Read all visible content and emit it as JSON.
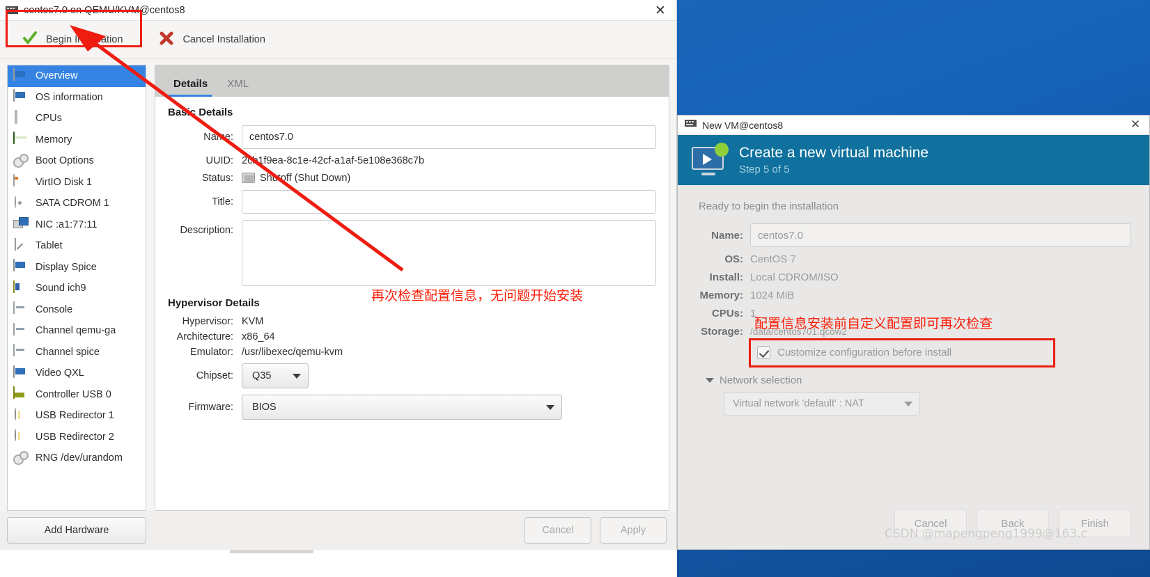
{
  "vm_window": {
    "title": "centos7.0 on QEMU/KVM@centos8",
    "title_icon": "vm-icon",
    "close_label": "✕",
    "toolbar": {
      "begin_label": "Begin Installation",
      "begin_icon": "green-check-icon",
      "cancel_label": "Cancel Installation",
      "cancel_icon": "red-x-icon"
    },
    "hardware_list": [
      {
        "label": "Overview",
        "icon": "monitor-icon",
        "selected": true
      },
      {
        "label": "OS information",
        "icon": "monitor-icon",
        "selected": false
      },
      {
        "label": "CPUs",
        "icon": "cpu-icon",
        "selected": false
      },
      {
        "label": "Memory",
        "icon": "memory-icon",
        "selected": false
      },
      {
        "label": "Boot Options",
        "icon": "gears-icon",
        "selected": false
      },
      {
        "label": "VirtIO Disk 1",
        "icon": "disk-icon",
        "selected": false
      },
      {
        "label": "SATA CDROM 1",
        "icon": "cdrom-icon",
        "selected": false
      },
      {
        "label": "NIC :a1:77:11",
        "icon": "nic-icon",
        "selected": false
      },
      {
        "label": "Tablet",
        "icon": "tablet-icon",
        "selected": false
      },
      {
        "label": "Display Spice",
        "icon": "monitor-icon",
        "selected": false
      },
      {
        "label": "Sound ich9",
        "icon": "sound-icon",
        "selected": false
      },
      {
        "label": "Console",
        "icon": "console-icon",
        "selected": false
      },
      {
        "label": "Channel qemu-ga",
        "icon": "console-icon",
        "selected": false
      },
      {
        "label": "Channel spice",
        "icon": "console-icon",
        "selected": false
      },
      {
        "label": "Video QXL",
        "icon": "monitor-icon",
        "selected": false
      },
      {
        "label": "Controller USB 0",
        "icon": "usb-controller-icon",
        "selected": false
      },
      {
        "label": "USB Redirector 1",
        "icon": "usb-redirector-icon",
        "selected": false
      },
      {
        "label": "USB Redirector 2",
        "icon": "usb-redirector-icon",
        "selected": false
      },
      {
        "label": "RNG /dev/urandom",
        "icon": "gears-icon",
        "selected": false
      }
    ],
    "tabs": [
      {
        "label": "Details",
        "active": true
      },
      {
        "label": "XML",
        "active": false
      }
    ],
    "basic_details": {
      "heading": "Basic Details",
      "name_label": "Name:",
      "name_value": "centos7.0",
      "uuid_label": "UUID:",
      "uuid_value": "2cb1f9ea-8c1e-42cf-a1af-5e108e368c7b",
      "status_label": "Status:",
      "status_value": "Shutoff (Shut Down)",
      "status_icon": "shutoff-monitor-icon",
      "title_label": "Title:",
      "title_value": "",
      "description_label": "Description:",
      "description_value": ""
    },
    "hypervisor_details": {
      "heading": "Hypervisor Details",
      "hypervisor_label": "Hypervisor:",
      "hypervisor_value": "KVM",
      "architecture_label": "Architecture:",
      "architecture_value": "x86_64",
      "emulator_label": "Emulator:",
      "emulator_value": "/usr/libexec/qemu-kvm",
      "chipset_label": "Chipset:",
      "chipset_value": "Q35",
      "firmware_label": "Firmware:",
      "firmware_value": "BIOS"
    },
    "footer": {
      "add_hardware_label": "Add Hardware",
      "cancel_label": "Cancel",
      "apply_label": "Apply"
    }
  },
  "annotations": {
    "left_note": "再次检查配置信息，无问题开始安装",
    "right_note": "配置信息安装前自定义配置即可再次检查",
    "highlight_color": "#ee1c11",
    "arrow_color": "#ee1c11"
  },
  "new_vm_dialog": {
    "title": "New VM@centos8",
    "title_icon": "vm-icon",
    "close_label": "✕",
    "header_title": "Create a new virtual machine",
    "header_step": "Step 5 of 5",
    "header_icon": "new-vm-icon",
    "ready_text": "Ready to begin the installation",
    "summary": [
      {
        "label": "Name:",
        "value": "centos7.0",
        "type": "input"
      },
      {
        "label": "OS:",
        "value": "CentOS 7",
        "type": "text"
      },
      {
        "label": "Install:",
        "value": "Local CDROM/ISO",
        "type": "text"
      },
      {
        "label": "Memory:",
        "value": "1024 MiB",
        "type": "text"
      },
      {
        "label": "CPUs:",
        "value": "1",
        "type": "text"
      },
      {
        "label": "Storage:",
        "value": "/data/centos701.qcow2",
        "type": "text-small"
      }
    ],
    "customize_label": "Customize configuration before install",
    "customize_checked": true,
    "network_section_label": "Network selection",
    "network_value": "Virtual network 'default' : NAT",
    "buttons": {
      "cancel_label": "Cancel",
      "back_label": "Back",
      "finish_label": "Finish"
    }
  },
  "watermark": "CSDN @mapengpeng1999@163.c",
  "colors": {
    "accent_blue": "#3584e4",
    "header_blue": "#10719e",
    "desktop_blue": "#1163b7",
    "annotation_red": "#fb1d08"
  }
}
